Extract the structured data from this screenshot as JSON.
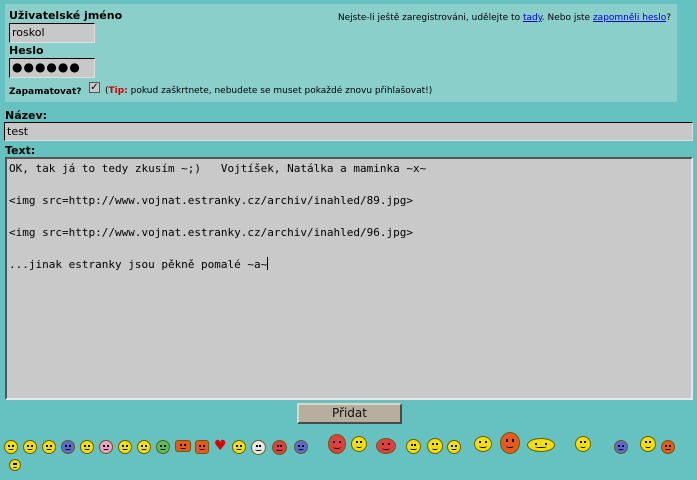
{
  "login": {
    "username_label": "Uživatelské jméno",
    "username_value": "roskol",
    "password_label": "Heslo",
    "password_value": "●●●●●●",
    "remember_label": "Zapamatovat?",
    "remember_checked": true,
    "check_mark": "✓",
    "tip_paren_open": "(",
    "tip_label": "Tip:",
    "tip_text": " pokud zaškrtnete, nebudete se muset pokaždé znovu přihlašovat!)",
    "register_text_1": "Nejste-li ještě zaregistrováni, udělejte to ",
    "register_link": "tady",
    "register_text_2": ". Nebo jste ",
    "forgot_link": "zapomněli heslo",
    "register_text_3": "?"
  },
  "form": {
    "title_label": "Název:",
    "title_value": "test",
    "text_label": "Text:",
    "text_lines": [
      "OK, tak já to tedy zkusím ~;)   Vojtíšek, Natálka a maminka ~x~",
      "",
      "<img src=http://www.vojnat.estranky.cz/archiv/inahled/89.jpg>",
      "",
      "<img src=http://www.vojnat.estranky.cz/archiv/inahled/96.jpg>",
      "",
      "...jinak estranky jsou pěkně pomalé ~a~"
    ],
    "submit_label": "Přidat"
  },
  "colors": {
    "background": "#66c1c1",
    "login_panel": "#8bcfcb",
    "link": "#0000cc",
    "tip": "#d40000"
  },
  "smileys": [
    "smile-icon",
    "grin-icon",
    "smile-icon",
    "sad-blue-icon",
    "frown-icon",
    "laugh-icon",
    "smile-icon",
    "wink-icon",
    "green-face-icon",
    "hand-icon",
    "thumbs-icon",
    "heart-icon",
    "smile-icon",
    "white-face-icon",
    "heart-face-icon",
    "blue-face-icon",
    "devil-icon",
    "surprised-icon",
    "pig-icon",
    "smile-icon",
    "big-grin-icon",
    "smile-icon",
    "bubble-icon",
    "flower-icon",
    "duck-icon",
    "chick-icon",
    "blue-ball-icon",
    "star-face-icon",
    "tomato-icon",
    "small-smile-icon"
  ]
}
